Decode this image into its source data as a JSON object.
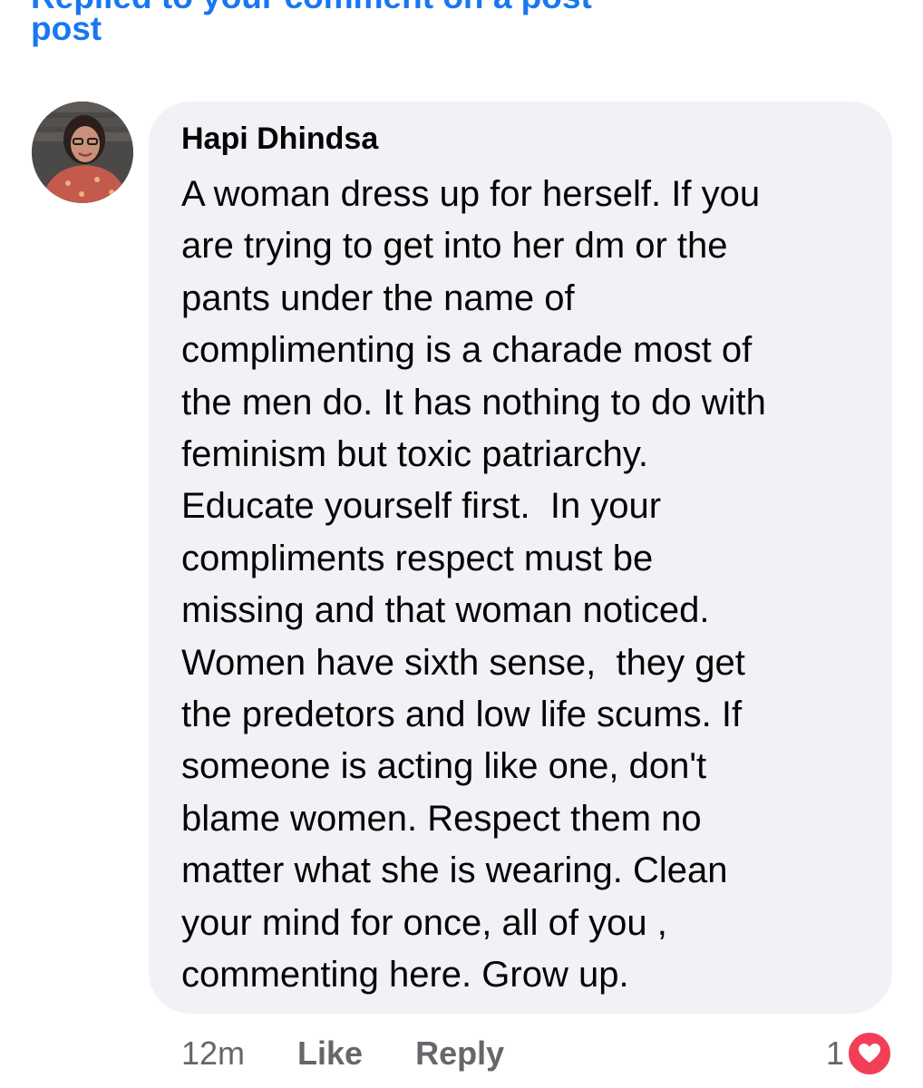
{
  "header": {
    "partial_text": "Replied to your comment on a post",
    "post_link": "post"
  },
  "comment": {
    "author": "Hapi Dhindsa",
    "lines": [
      "A woman dress up for herself. If you",
      "are trying to get into her dm or the",
      "pants under the name of",
      "complimenting is a charade most of",
      "the men do. It has nothing to do with",
      "feminism but toxic patriarchy.",
      "Educate yourself first.  In your",
      "compliments respect must be",
      "missing and that woman noticed.",
      "Women have sixth sense,  they get",
      "the predetors and low life scums. If",
      "someone is acting like one, don't",
      "blame women. Respect them no",
      "matter what she is wearing. Clean",
      "your mind for once, all of you ,",
      "commenting here. Grow up."
    ],
    "timestamp": "12m",
    "like_label": "Like",
    "reply_label": "Reply",
    "reaction_count": "1",
    "reaction_icon": "heart-icon",
    "reaction_color": "#f33e58"
  },
  "colors": {
    "link": "#1877f2",
    "bubble": "#f0f2f5",
    "meta_text": "#65676b"
  }
}
